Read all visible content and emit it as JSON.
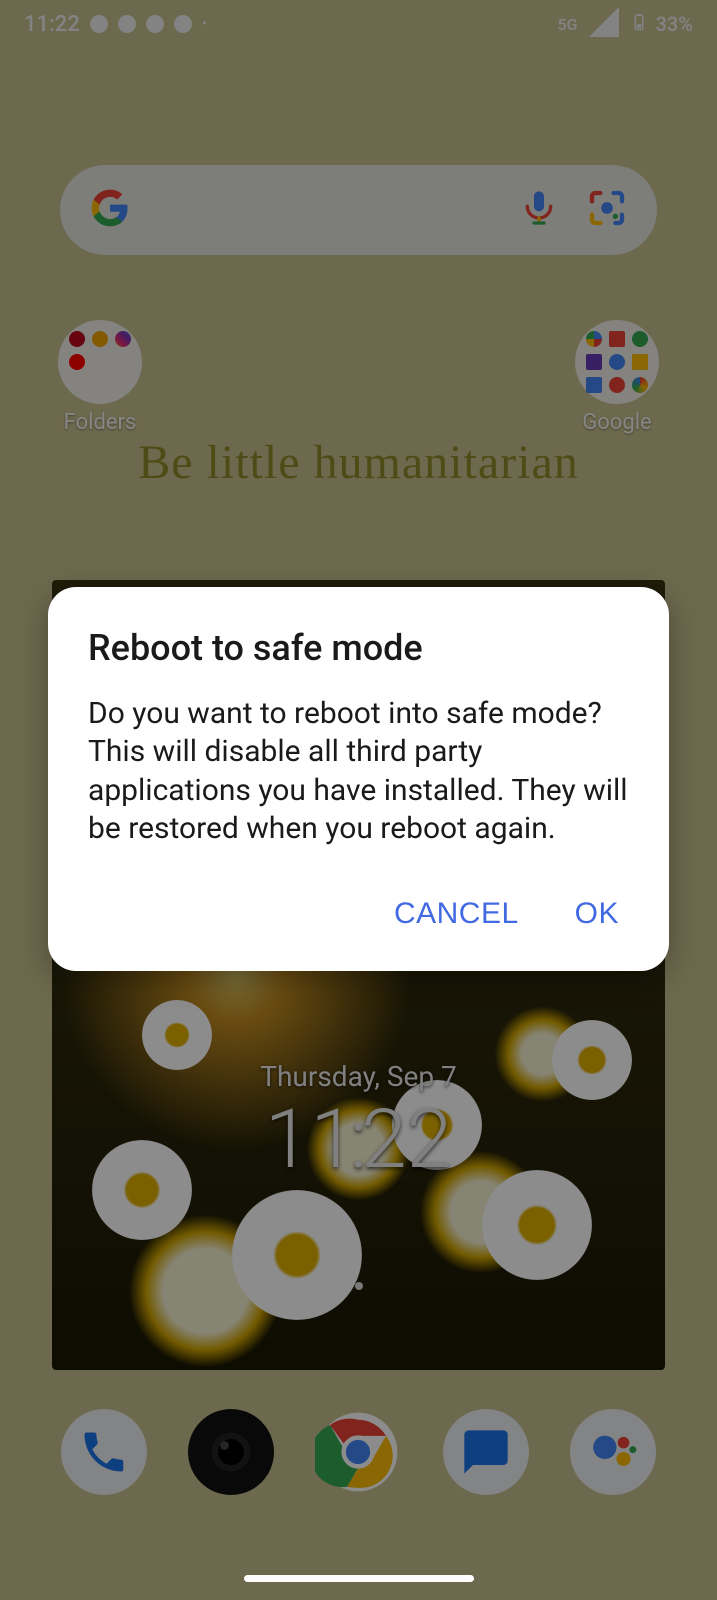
{
  "statusbar": {
    "time": "11:22",
    "battery_text": "33%",
    "network_label": "5G"
  },
  "search": {
    "placeholder": ""
  },
  "folders": {
    "left_label": "Folders",
    "right_label": "Google"
  },
  "wallpaper": {
    "quote": "Be little humanitarian"
  },
  "widget": {
    "date": "Thursday, Sep 7",
    "time_h": "11",
    "time_m": "22"
  },
  "dialog": {
    "title": "Reboot to safe mode",
    "body": "Do you want to reboot into safe mode? This will disable all third party applications you have installed. They will be restored when you reboot again.",
    "cancel": "CANCEL",
    "ok": "OK"
  },
  "dock": {
    "phone": "Phone",
    "camera": "Camera",
    "chrome": "Chrome",
    "messages": "Messages",
    "assistant": "Assistant"
  }
}
